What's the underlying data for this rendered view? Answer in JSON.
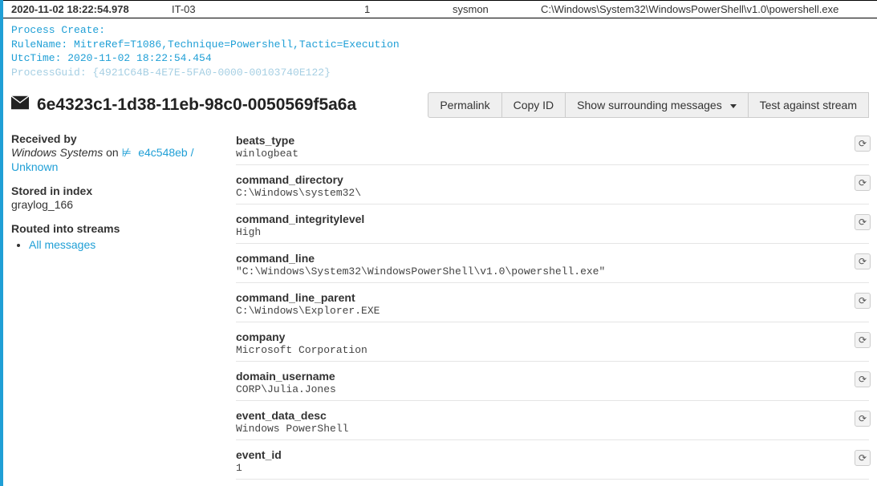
{
  "top": {
    "timestamp": "2020-11-02 18:22:54.978",
    "host": "IT-03",
    "num": "1",
    "source": "sysmon",
    "path": "C:\\Windows\\System32\\WindowsPowerShell\\v1.0\\powershell.exe"
  },
  "raw": {
    "l1": "Process Create:",
    "l2": "RuleName: MitreRef=T1086,Technique=Powershell,Tactic=Execution",
    "l3": "UtcTime: 2020-11-02 18:22:54.454",
    "l4": "ProcessGuid: {4921C64B-4E7E-5FA0-0000-00103740E122}"
  },
  "message_id": "6e4323c1-1d38-11eb-98c0-0050569f5a6a",
  "buttons": {
    "permalink": "Permalink",
    "copyid": "Copy ID",
    "surrounding": "Show surrounding messages",
    "test": "Test against stream"
  },
  "side": {
    "received_label": "Received by",
    "received_by_system": "Windows Systems",
    "received_on": " on ",
    "received_node": "e4c548eb / Unknown",
    "stored_label": "Stored in index",
    "stored_index": "graylog_166",
    "routed_label": "Routed into streams",
    "stream0": "All messages"
  },
  "fields": [
    {
      "k": "beats_type",
      "v": "winlogbeat"
    },
    {
      "k": "command_directory",
      "v": "C:\\Windows\\system32\\"
    },
    {
      "k": "command_integritylevel",
      "v": "High"
    },
    {
      "k": "command_line",
      "v": "\"C:\\Windows\\System32\\WindowsPowerShell\\v1.0\\powershell.exe\""
    },
    {
      "k": "command_line_parent",
      "v": "C:\\Windows\\Explorer.EXE"
    },
    {
      "k": "company",
      "v": "Microsoft Corporation"
    },
    {
      "k": "domain_username",
      "v": "CORP\\Julia.Jones"
    },
    {
      "k": "event_data_desc",
      "v": "Windows PowerShell"
    },
    {
      "k": "event_id",
      "v": "1"
    }
  ],
  "icons": {
    "gear": "⚙"
  }
}
